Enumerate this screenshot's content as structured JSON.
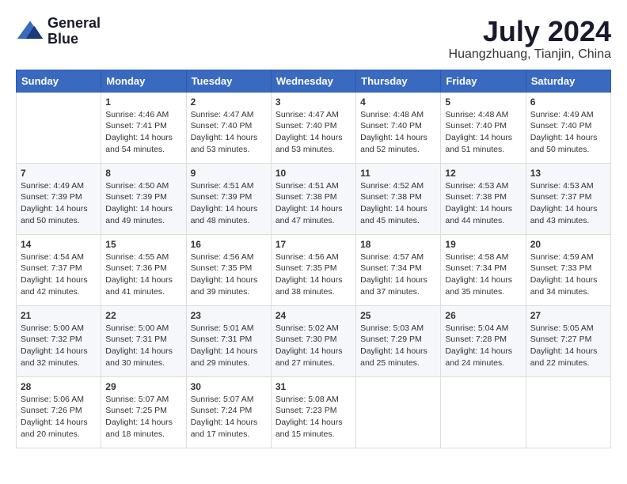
{
  "header": {
    "logo_line1": "General",
    "logo_line2": "Blue",
    "month": "July 2024",
    "location": "Huangzhuang, Tianjin, China"
  },
  "days_of_week": [
    "Sunday",
    "Monday",
    "Tuesday",
    "Wednesday",
    "Thursday",
    "Friday",
    "Saturday"
  ],
  "weeks": [
    [
      {
        "day": "",
        "content": ""
      },
      {
        "day": "1",
        "content": "Sunrise: 4:46 AM\nSunset: 7:41 PM\nDaylight: 14 hours\nand 54 minutes."
      },
      {
        "day": "2",
        "content": "Sunrise: 4:47 AM\nSunset: 7:40 PM\nDaylight: 14 hours\nand 53 minutes."
      },
      {
        "day": "3",
        "content": "Sunrise: 4:47 AM\nSunset: 7:40 PM\nDaylight: 14 hours\nand 53 minutes."
      },
      {
        "day": "4",
        "content": "Sunrise: 4:48 AM\nSunset: 7:40 PM\nDaylight: 14 hours\nand 52 minutes."
      },
      {
        "day": "5",
        "content": "Sunrise: 4:48 AM\nSunset: 7:40 PM\nDaylight: 14 hours\nand 51 minutes."
      },
      {
        "day": "6",
        "content": "Sunrise: 4:49 AM\nSunset: 7:40 PM\nDaylight: 14 hours\nand 50 minutes."
      }
    ],
    [
      {
        "day": "7",
        "content": "Sunrise: 4:49 AM\nSunset: 7:39 PM\nDaylight: 14 hours\nand 50 minutes."
      },
      {
        "day": "8",
        "content": "Sunrise: 4:50 AM\nSunset: 7:39 PM\nDaylight: 14 hours\nand 49 minutes."
      },
      {
        "day": "9",
        "content": "Sunrise: 4:51 AM\nSunset: 7:39 PM\nDaylight: 14 hours\nand 48 minutes."
      },
      {
        "day": "10",
        "content": "Sunrise: 4:51 AM\nSunset: 7:38 PM\nDaylight: 14 hours\nand 47 minutes."
      },
      {
        "day": "11",
        "content": "Sunrise: 4:52 AM\nSunset: 7:38 PM\nDaylight: 14 hours\nand 45 minutes."
      },
      {
        "day": "12",
        "content": "Sunrise: 4:53 AM\nSunset: 7:38 PM\nDaylight: 14 hours\nand 44 minutes."
      },
      {
        "day": "13",
        "content": "Sunrise: 4:53 AM\nSunset: 7:37 PM\nDaylight: 14 hours\nand 43 minutes."
      }
    ],
    [
      {
        "day": "14",
        "content": "Sunrise: 4:54 AM\nSunset: 7:37 PM\nDaylight: 14 hours\nand 42 minutes."
      },
      {
        "day": "15",
        "content": "Sunrise: 4:55 AM\nSunset: 7:36 PM\nDaylight: 14 hours\nand 41 minutes."
      },
      {
        "day": "16",
        "content": "Sunrise: 4:56 AM\nSunset: 7:35 PM\nDaylight: 14 hours\nand 39 minutes."
      },
      {
        "day": "17",
        "content": "Sunrise: 4:56 AM\nSunset: 7:35 PM\nDaylight: 14 hours\nand 38 minutes."
      },
      {
        "day": "18",
        "content": "Sunrise: 4:57 AM\nSunset: 7:34 PM\nDaylight: 14 hours\nand 37 minutes."
      },
      {
        "day": "19",
        "content": "Sunrise: 4:58 AM\nSunset: 7:34 PM\nDaylight: 14 hours\nand 35 minutes."
      },
      {
        "day": "20",
        "content": "Sunrise: 4:59 AM\nSunset: 7:33 PM\nDaylight: 14 hours\nand 34 minutes."
      }
    ],
    [
      {
        "day": "21",
        "content": "Sunrise: 5:00 AM\nSunset: 7:32 PM\nDaylight: 14 hours\nand 32 minutes."
      },
      {
        "day": "22",
        "content": "Sunrise: 5:00 AM\nSunset: 7:31 PM\nDaylight: 14 hours\nand 30 minutes."
      },
      {
        "day": "23",
        "content": "Sunrise: 5:01 AM\nSunset: 7:31 PM\nDaylight: 14 hours\nand 29 minutes."
      },
      {
        "day": "24",
        "content": "Sunrise: 5:02 AM\nSunset: 7:30 PM\nDaylight: 14 hours\nand 27 minutes."
      },
      {
        "day": "25",
        "content": "Sunrise: 5:03 AM\nSunset: 7:29 PM\nDaylight: 14 hours\nand 25 minutes."
      },
      {
        "day": "26",
        "content": "Sunrise: 5:04 AM\nSunset: 7:28 PM\nDaylight: 14 hours\nand 24 minutes."
      },
      {
        "day": "27",
        "content": "Sunrise: 5:05 AM\nSunset: 7:27 PM\nDaylight: 14 hours\nand 22 minutes."
      }
    ],
    [
      {
        "day": "28",
        "content": "Sunrise: 5:06 AM\nSunset: 7:26 PM\nDaylight: 14 hours\nand 20 minutes."
      },
      {
        "day": "29",
        "content": "Sunrise: 5:07 AM\nSunset: 7:25 PM\nDaylight: 14 hours\nand 18 minutes."
      },
      {
        "day": "30",
        "content": "Sunrise: 5:07 AM\nSunset: 7:24 PM\nDaylight: 14 hours\nand 17 minutes."
      },
      {
        "day": "31",
        "content": "Sunrise: 5:08 AM\nSunset: 7:23 PM\nDaylight: 14 hours\nand 15 minutes."
      },
      {
        "day": "",
        "content": ""
      },
      {
        "day": "",
        "content": ""
      },
      {
        "day": "",
        "content": ""
      }
    ]
  ]
}
